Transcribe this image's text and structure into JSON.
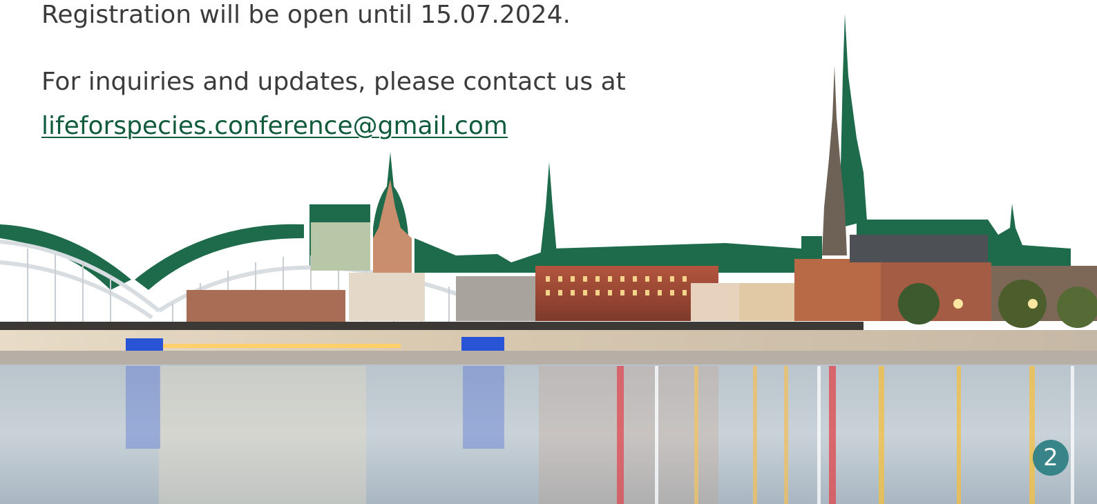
{
  "slide": {
    "registration_text": "Registration will be open until 15.07.2024.",
    "contact_text": "For inquiries and updates, please contact us at",
    "email": "lifeforspecies.conference@gmail.com",
    "page_number": "2"
  },
  "colors": {
    "accent_green": "#1a6a4a",
    "link_green": "#0f5b3c",
    "badge_teal": "#2d7f83"
  },
  "image": {
    "description_icon": "city-skyline-photo"
  }
}
